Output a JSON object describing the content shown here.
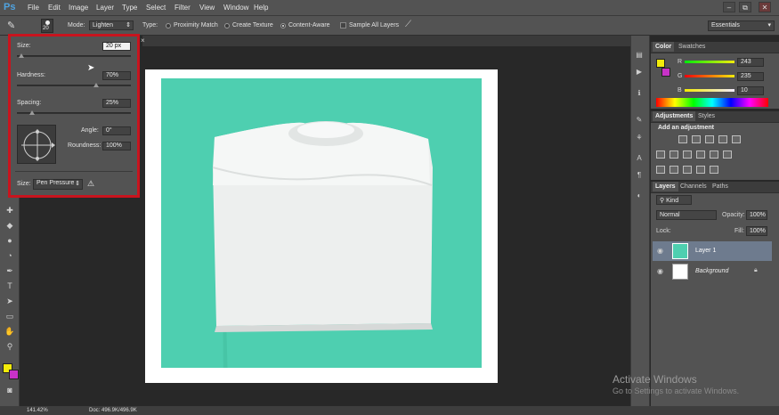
{
  "app": {
    "logo": "Ps"
  },
  "menu": [
    "File",
    "Edit",
    "Image",
    "Layer",
    "Type",
    "Select",
    "Filter",
    "View",
    "Window",
    "Help"
  ],
  "window_controls": [
    "–",
    "⧉",
    "✕"
  ],
  "options": {
    "brush_size": "20",
    "mode_label": "Mode:",
    "mode_value": "Lighten",
    "type_label": "Type:",
    "proximity": "Proximity Match",
    "create_texture": "Create Texture",
    "content_aware": "Content-Aware",
    "sample_all": "Sample All Layers",
    "workspace": "Essentials"
  },
  "brush_panel": {
    "size_label": "Size:",
    "size_value": "20 px",
    "hardness_label": "Hardness:",
    "hardness_value": "70%",
    "spacing_label": "Spacing:",
    "spacing_value": "25%",
    "angle_label": "Angle:",
    "angle_value": "0°",
    "roundness_label": "Roundness:",
    "roundness_value": "100%",
    "size_ctrl_label": "Size:",
    "size_ctrl_value": "Pen Pressure"
  },
  "color_panel": {
    "tabs": [
      "Color",
      "Swatches"
    ],
    "channels": [
      {
        "name": "R",
        "value": "243"
      },
      {
        "name": "G",
        "value": "235"
      },
      {
        "name": "B",
        "value": "10"
      }
    ],
    "foreground": "#f3eb0a",
    "background": "#c832c8"
  },
  "adjustments_panel": {
    "tabs": [
      "Adjustments",
      "Styles"
    ],
    "title": "Add an adjustment"
  },
  "layers_panel": {
    "tabs": [
      "Layers",
      "Channels",
      "Paths"
    ],
    "kind_label": "Kind",
    "blend_mode": "Normal",
    "opacity_label": "Opacity:",
    "opacity_value": "100%",
    "lock_label": "Lock:",
    "fill_label": "Fill:",
    "fill_value": "100%",
    "layers": [
      {
        "name": "Layer 1"
      },
      {
        "name": "Background"
      }
    ]
  },
  "status": {
    "zoom": "141.42%",
    "doc": "Doc: 496.9K/496.9K"
  },
  "watermark": {
    "line1": "Activate Windows",
    "line2": "Go to Settings to activate Windows."
  }
}
